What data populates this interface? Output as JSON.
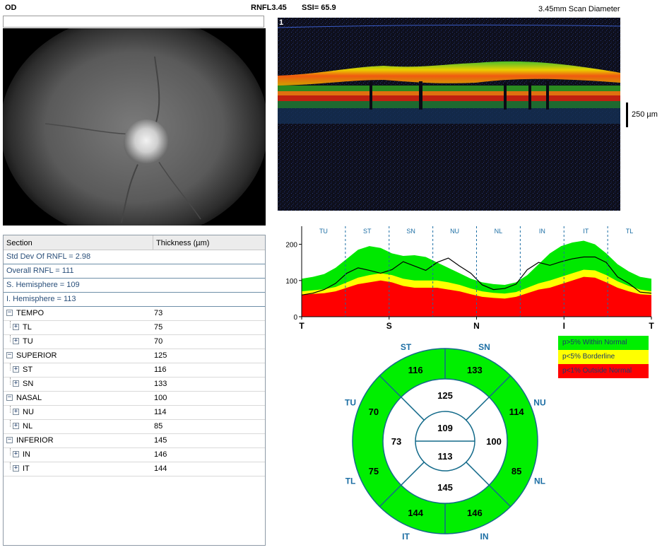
{
  "header": {
    "eye": "OD",
    "rnfl": "RNFL3.45",
    "ssi": "SSI= 65.9",
    "scan_diameter": "3.45mm Scan Diameter"
  },
  "bscan": {
    "frame_number": "1",
    "scale_label": "250 µm"
  },
  "table": {
    "columns": [
      "Section",
      "Thickness (µm)"
    ],
    "summary": [
      "Std Dev Of RNFL = 2.98",
      "Overall RNFL = 111",
      "S. Hemisphere = 109",
      "I. Hemisphere = 113"
    ],
    "rows": [
      {
        "level": 0,
        "label": "TEMPO",
        "value": "73",
        "expander": "−"
      },
      {
        "level": 1,
        "label": "TL",
        "value": "75",
        "expander": "+"
      },
      {
        "level": 1,
        "label": "TU",
        "value": "70",
        "expander": "+"
      },
      {
        "level": 0,
        "label": "SUPERIOR",
        "value": "125",
        "expander": "−"
      },
      {
        "level": 1,
        "label": "ST",
        "value": "116",
        "expander": "+"
      },
      {
        "level": 1,
        "label": "SN",
        "value": "133",
        "expander": "+"
      },
      {
        "level": 0,
        "label": "NASAL",
        "value": "100",
        "expander": "−"
      },
      {
        "level": 1,
        "label": "NU",
        "value": "114",
        "expander": "+"
      },
      {
        "level": 1,
        "label": "NL",
        "value": "85",
        "expander": "+"
      },
      {
        "level": 0,
        "label": "INFERIOR",
        "value": "145",
        "expander": "−"
      },
      {
        "level": 1,
        "label": "IN",
        "value": "146",
        "expander": "+"
      },
      {
        "level": 1,
        "label": "IT",
        "value": "144",
        "expander": "+"
      }
    ]
  },
  "chart_data": {
    "type": "area",
    "title": "",
    "xlabel": "",
    "ylabel": "",
    "ylim": [
      0,
      250
    ],
    "yticks": [
      0,
      100,
      200
    ],
    "xticks": [
      "T",
      "S",
      "N",
      "I",
      "T"
    ],
    "segments": [
      "TU",
      "ST",
      "SN",
      "NU",
      "NL",
      "IN",
      "IT",
      "TL"
    ],
    "x": [
      0,
      16,
      32,
      48,
      64,
      80,
      96,
      112,
      128,
      144,
      160,
      176,
      192,
      208,
      224,
      240,
      256,
      272,
      288,
      304,
      320,
      336,
      352,
      368,
      384,
      400,
      416,
      432,
      448,
      464,
      480,
      496
    ],
    "series": [
      {
        "name": "",
        "values": [
          60,
          63,
          65,
          70,
          80,
          90,
          95,
          100,
          95,
          85,
          80,
          80,
          80,
          75,
          70,
          62,
          55,
          52,
          50,
          55,
          65,
          75,
          80,
          90,
          100,
          110,
          108,
          95,
          80,
          70,
          62,
          60
        ]
      },
      {
        "name": "",
        "values": [
          70,
          73,
          76,
          82,
          95,
          108,
          115,
          120,
          115,
          105,
          100,
          100,
          100,
          95,
          88,
          78,
          70,
          66,
          64,
          68,
          80,
          92,
          100,
          110,
          120,
          130,
          128,
          115,
          98,
          85,
          75,
          70
        ]
      },
      {
        "name": "",
        "values": [
          105,
          110,
          118,
          135,
          160,
          185,
          195,
          190,
          175,
          168,
          170,
          165,
          150,
          135,
          120,
          105,
          95,
          90,
          88,
          95,
          115,
          145,
          175,
          195,
          205,
          210,
          200,
          175,
          145,
          125,
          110,
          105
        ]
      },
      {
        "name": "",
        "values": [
          60,
          65,
          75,
          92,
          120,
          135,
          128,
          120,
          130,
          152,
          140,
          128,
          150,
          162,
          140,
          120,
          88,
          75,
          78,
          90,
          130,
          150,
          142,
          152,
          160,
          165,
          165,
          150,
          110,
          92,
          68,
          65
        ]
      }
    ]
  },
  "legend": [
    {
      "label": "p>5% Within Normal",
      "color": "#00ef00",
      "text_color": "#1c3a6a"
    },
    {
      "label": "p<5% Borderline",
      "color": "#ffff00",
      "text_color": "#1c3a6a"
    },
    {
      "label": "p<1% Outside Normal",
      "color": "#ff0000",
      "text_color": "#1c3a6a"
    }
  ],
  "circle": {
    "outer": {
      "ST": "116",
      "SN": "133",
      "NU": "114",
      "NL": "85",
      "IN": "146",
      "IT": "144",
      "TL": "75",
      "TU": "70"
    },
    "outer_labels": [
      "ST",
      "SN",
      "NU",
      "NL",
      "IN",
      "IT",
      "TL",
      "TU"
    ],
    "middle": {
      "superior": "125",
      "nasal": "100",
      "inferior": "145",
      "temporal": "73"
    },
    "inner": {
      "superior": "109",
      "inferior": "113"
    },
    "fill_color": "#00ef00",
    "label_color": "#1c6ea4"
  }
}
